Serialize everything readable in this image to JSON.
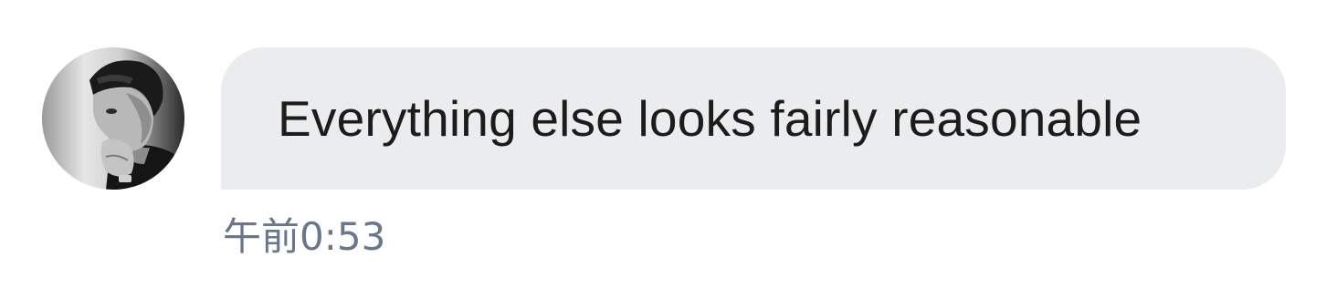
{
  "message": {
    "sender_avatar": "avatar-photo",
    "text": "Everything else looks fairly reasonable",
    "timestamp": "午前0:53"
  },
  "colors": {
    "bubble_background": "#ebecee",
    "message_text": "#1c1c1c",
    "timestamp_text": "#68788a"
  }
}
